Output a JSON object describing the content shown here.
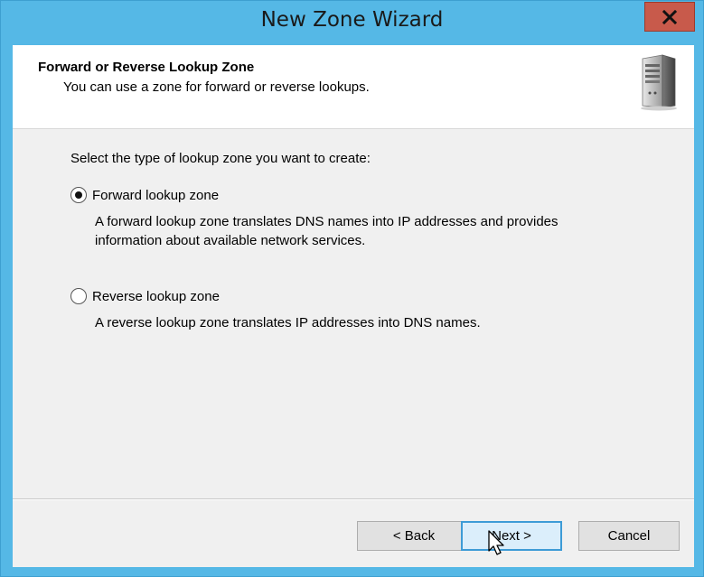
{
  "window": {
    "title": "New Zone Wizard",
    "close_label": "X"
  },
  "header": {
    "title": "Forward or Reverse Lookup Zone",
    "subtitle": "You can use a zone for forward or reverse lookups.",
    "icon": "server-icon"
  },
  "content": {
    "prompt": "Select the type of lookup zone you want to create:",
    "options": [
      {
        "label": "Forward lookup zone",
        "selected": true,
        "description_lines": [
          "A forward lookup zone translates DNS names into IP addresses and provides",
          "information about available network services."
        ]
      },
      {
        "label": "Reverse lookup zone",
        "selected": false,
        "description_lines": [
          "A reverse lookup zone translates IP addresses into DNS names."
        ]
      }
    ]
  },
  "buttons": {
    "back": "< Back",
    "next": "Next >",
    "cancel": "Cancel"
  },
  "colors": {
    "frame": "#55b8e6",
    "close": "#c85a4b",
    "primary_border": "#3d9bd6"
  }
}
